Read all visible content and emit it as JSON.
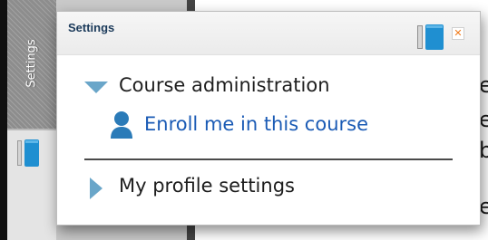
{
  "dock": {
    "label": "Settings"
  },
  "panel": {
    "title": "Settings",
    "items": [
      {
        "label": "Course administration",
        "expanded": true
      },
      {
        "label": "Enroll me in this course"
      },
      {
        "label": "My profile settings",
        "expanded": false
      }
    ]
  },
  "background_fragments": [
    "r",
    "e",
    "e",
    "b",
    "e"
  ],
  "colors": {
    "link": "#1b5bb5",
    "accent_blue": "#1f8fd1",
    "close_orange": "#f07a1a",
    "title": "#1b3a5a"
  }
}
